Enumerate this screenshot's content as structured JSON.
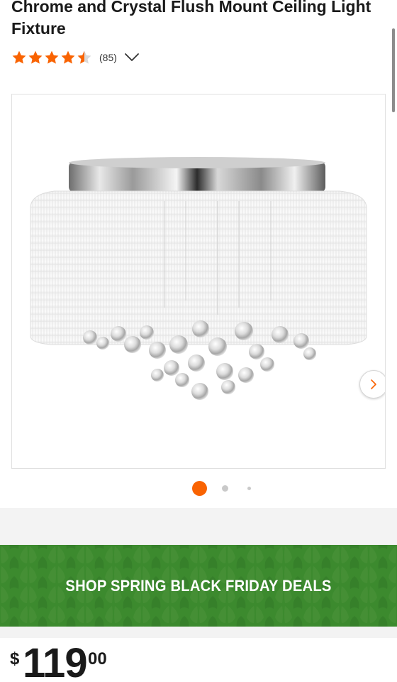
{
  "product": {
    "title": "Chrome and Crystal Flush Mount Ceiling Light Fixture",
    "rating": 4.5,
    "review_count": "(85)",
    "image_alt": "Chrome and crystal flush mount ceiling light with white fabric drum shade"
  },
  "gallery": {
    "active_index": 0,
    "dot_count": 3,
    "next_icon": "chevron-right-icon"
  },
  "promo": {
    "label": "SHOP SPRING BLACK FRIDAY DEALS",
    "background_color": "#3c8a2e"
  },
  "price": {
    "currency": "$",
    "dollars": "119",
    "cents": "00"
  },
  "colors": {
    "accent": "#f96302",
    "star": "#f96302",
    "text": "#1a1a1a"
  }
}
